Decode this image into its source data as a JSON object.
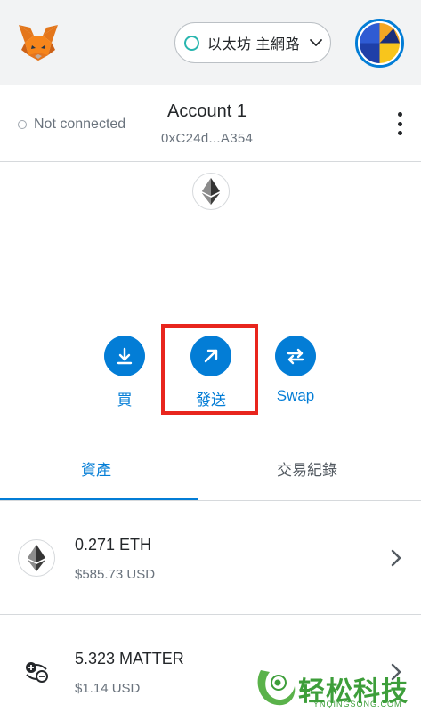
{
  "header": {
    "network_label": "以太坊 主網路"
  },
  "account": {
    "connection_status": "Not connected",
    "name": "Account 1",
    "address": "0xC24d...A354"
  },
  "actions": {
    "buy_label": "買",
    "send_label": "發送",
    "swap_label": "Swap"
  },
  "tabs": {
    "assets_label": "資產",
    "activity_label": "交易紀錄"
  },
  "assets": [
    {
      "amount": "0.271 ETH",
      "usd": "$585.73 USD",
      "icon": "ethereum-icon"
    },
    {
      "amount": "5.323 MATTER",
      "usd": "$1.14 USD",
      "icon": "matter-token-icon"
    }
  ],
  "watermark": {
    "text": "轻松科技",
    "sub": "YNQINGSONG.COM"
  },
  "colors": {
    "accent": "#037dd6",
    "highlight_border": "#e8251d",
    "network_dot": "#29b6af"
  }
}
